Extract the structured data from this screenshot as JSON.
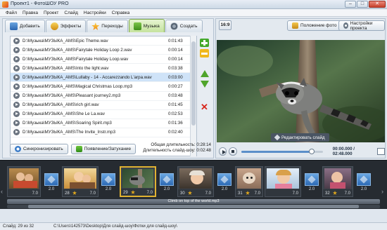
{
  "window": {
    "title": "Проект1 - ФотоШОУ PRO"
  },
  "menu": [
    "Файл",
    "Правка",
    "Проект",
    "Слайд",
    "Настройки",
    "Справка"
  ],
  "tabs": [
    {
      "label": "Добавить",
      "icon": "add-photo-icon"
    },
    {
      "label": "Эффекты",
      "icon": "effects-icon"
    },
    {
      "label": "Переходы",
      "icon": "transitions-star-icon"
    },
    {
      "label": "Музыка",
      "icon": "music-icon",
      "active": true
    },
    {
      "label": "Создать",
      "icon": "create-disc-icon"
    }
  ],
  "music_list": [
    {
      "path": "D:\\Музыка\\МУЗЫКА_AMS\\Epic Theme.wav",
      "duration": "0:01:43"
    },
    {
      "path": "D:\\Музыка\\МУЗЫКА_AMS\\Fairytale Holiday Loop 2.wav",
      "duration": "0:00:14"
    },
    {
      "path": "D:\\Музыка\\МУЗЫКА_AMS\\Fairytale Holiday Loop.wav",
      "duration": "0:00:14"
    },
    {
      "path": "D:\\Музыка\\МУЗЫКА_AMS\\Into the light.wav",
      "duration": "0:03:38"
    },
    {
      "path": "D:\\Музыка\\МУЗЫКА_AMS\\Lullaby - 14 - Accarezzando L'arpa.wav",
      "duration": "0:03:00",
      "selected": true
    },
    {
      "path": "D:\\Музыка\\МУЗЫКА_AMS\\Magical Christmas Loop.mp3",
      "duration": "0:00:27"
    },
    {
      "path": "D:\\Музыка\\МУЗЫКА_AMS\\Pleasant journey2.mp3",
      "duration": "0:03:48"
    },
    {
      "path": "D:\\Музыка\\МУЗЫКА_AMS\\rich girl.wav",
      "duration": "0:01:45"
    },
    {
      "path": "D:\\Музыка\\МУЗЫКА_AMS\\She Le La.wav",
      "duration": "0:02:53"
    },
    {
      "path": "D:\\Музыка\\МУЗЫКА_AMS\\Soaring Spirit.mp3",
      "duration": "0:01:36"
    },
    {
      "path": "D:\\Музыка\\МУЗЫКА_AMS\\The Invite_Instr.mp3",
      "duration": "0:02:40"
    }
  ],
  "bottom_buttons": {
    "sync": "Синхронизировать",
    "fade": "Появление/Затухание"
  },
  "durations": {
    "total_label": "Общая длительность:",
    "total_value": "0:28:14",
    "slideshow_label": "Длительность слайд-шоу:",
    "slideshow_value": "0:02:48"
  },
  "right_toolbar": {
    "ratio": "16:9",
    "photo_position": "Положение фото",
    "project_settings": "Настройки проекта"
  },
  "preview": {
    "edit_slide": "Редактировать слайд"
  },
  "player": {
    "time": "00:00.000 / 02:48.000",
    "progress": 0.86
  },
  "timeline": {
    "slides": [
      {
        "num": "",
        "dur": "7.0",
        "scene": "kids"
      },
      {
        "num": "28",
        "dur": "7.0",
        "scene": "family"
      },
      {
        "num": "29",
        "dur": "7.0",
        "scene": "raccoon",
        "active": true
      },
      {
        "num": "30",
        "dur": "7.0",
        "scene": "baby"
      },
      {
        "num": "31",
        "dur": "7.0",
        "scene": "dog"
      },
      {
        "num": "",
        "dur": "7.0",
        "scene": "girl"
      },
      {
        "num": "32",
        "dur": "7.0",
        "scene": "child"
      }
    ],
    "transitions": [
      "2.0",
      "2.0",
      "2.0",
      "2.0",
      "2.0",
      "2.0",
      "2.0"
    ],
    "music_track": "Climb on top of the world.mp3"
  },
  "status": {
    "slide_info": "Слайд: 29 из 32",
    "path": "C:\\Users\\142573\\Desktop\\Для слайд-шоу\\Фотки для слайд-шоу\\"
  },
  "colors": {
    "accent": "#e0b232",
    "selection": "#cfe3f8",
    "timeline_bg": "#262b31"
  }
}
